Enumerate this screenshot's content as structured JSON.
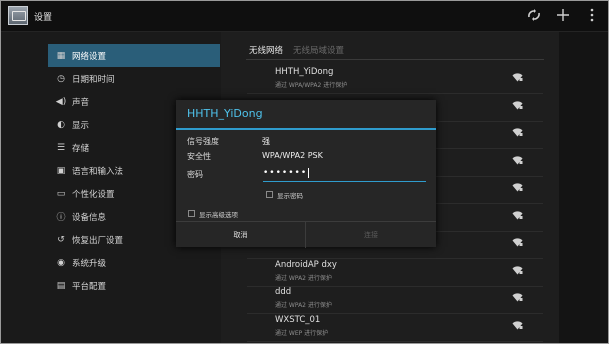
{
  "app": {
    "title": "设置"
  },
  "topbar": {
    "icons": [
      "wifi-scan-icon",
      "add-icon",
      "overflow-menu-icon"
    ]
  },
  "sidebar": {
    "items": [
      {
        "label": "网络设置",
        "icon": "network-icon"
      },
      {
        "label": "日期和时间",
        "icon": "clock-icon"
      },
      {
        "label": "声音",
        "icon": "sound-icon"
      },
      {
        "label": "显示",
        "icon": "display-icon"
      },
      {
        "label": "存储",
        "icon": "storage-icon"
      },
      {
        "label": "语言和输入法",
        "icon": "language-icon"
      },
      {
        "label": "个性化设置",
        "icon": "monitor-icon"
      },
      {
        "label": "设备信息",
        "icon": "info-icon"
      },
      {
        "label": "恢复出厂设置",
        "icon": "reset-icon"
      },
      {
        "label": "系统升级",
        "icon": "upgrade-icon"
      },
      {
        "label": "平台配置",
        "icon": "platform-icon"
      }
    ]
  },
  "content": {
    "header": {
      "wireless": "无线网络",
      "wired": "无线局域设置"
    },
    "networks": [
      {
        "ssid": "HHTH_YiDong",
        "security": "通过 WPA/WPA2 进行保护"
      },
      {
        "ssid": "",
        "security": ""
      },
      {
        "ssid": "",
        "security": ""
      },
      {
        "ssid": "",
        "security": ""
      },
      {
        "ssid": "",
        "security": ""
      },
      {
        "ssid": "",
        "security": ""
      },
      {
        "ssid": "",
        "security": ""
      },
      {
        "ssid": "AndroidAP dxy",
        "security": "通过 WPA2 进行保护"
      },
      {
        "ssid": "ddd",
        "security": "通过 WPA2 进行保护"
      },
      {
        "ssid": "WXSTC_01",
        "security": "通过 WEP 进行保护"
      }
    ]
  },
  "dialog": {
    "title": "HHTH_YiDong",
    "signal_label": "信号强度",
    "signal_value": "强",
    "security_label": "安全性",
    "security_value": "WPA/WPA2 PSK",
    "password_label": "密码",
    "password_value": "•••••••",
    "show_password": "显示密码",
    "show_advanced": "显示高级选项",
    "cancel": "取消",
    "connect": "连接"
  },
  "colors": {
    "accent": "#2f9ccd",
    "title_blue": "#4fc3ec",
    "selected_bg": "#2a5e79"
  }
}
